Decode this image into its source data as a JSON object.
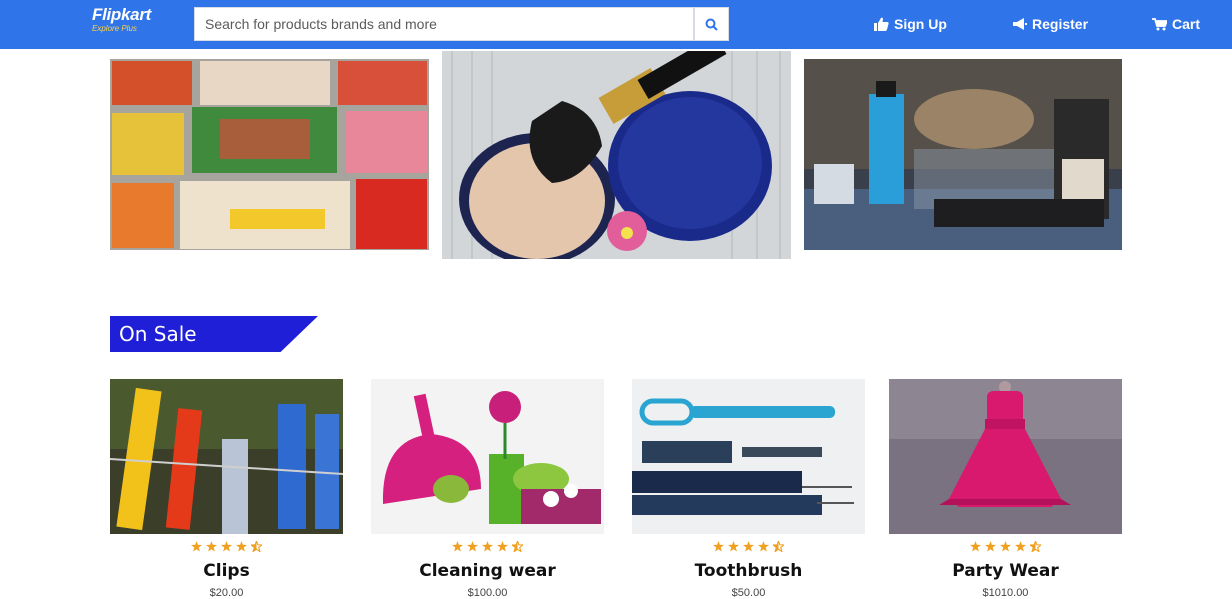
{
  "header": {
    "logo_name": "Flipkart",
    "logo_tagline": "Explore Plus",
    "search_placeholder": "Search for products brands and more",
    "links": {
      "signup": "Sign Up",
      "register": "Register",
      "cart": "Cart"
    },
    "colors": {
      "bar": "#2f74e8",
      "tagline": "#ffd24c"
    }
  },
  "banners": [
    {
      "name": "candy-banner"
    },
    {
      "name": "makeup-banner"
    },
    {
      "name": "grooming-banner"
    }
  ],
  "section": {
    "title": "On Sale",
    "color": "#1f1fd8"
  },
  "products": [
    {
      "name": "Clips",
      "price": "$20.00",
      "rating": 4.5
    },
    {
      "name": "Cleaning wear",
      "price": "$100.00",
      "rating": 4.5
    },
    {
      "name": "Toothbrush",
      "price": "$50.00",
      "rating": 4.5
    },
    {
      "name": "Party Wear",
      "price": "$1010.00",
      "rating": 4.5
    }
  ],
  "icons": {
    "search": "search-icon",
    "signup": "thumbs-up-icon",
    "register": "megaphone-icon",
    "cart": "cart-icon",
    "star": "star-icon"
  }
}
